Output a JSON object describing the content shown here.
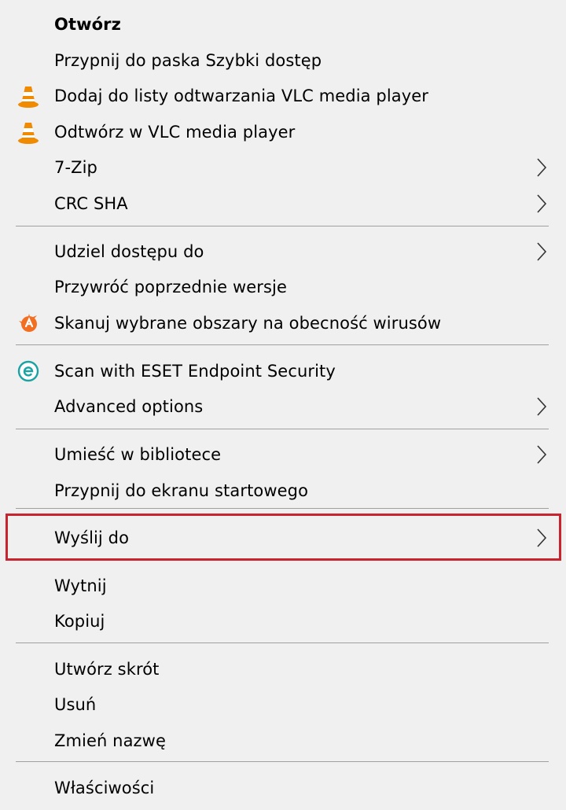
{
  "menu": {
    "groups": [
      [
        {
          "label": "Otwórz",
          "bold": true,
          "icon": null,
          "submenu": false
        },
        {
          "label": "Przypnij do paska Szybki dostęp",
          "bold": false,
          "icon": null,
          "submenu": false
        },
        {
          "label": "Dodaj do listy odtwarzania VLC media player",
          "bold": false,
          "icon": "vlc-cone-icon",
          "submenu": false
        },
        {
          "label": "Odtwórz w VLC media player",
          "bold": false,
          "icon": "vlc-cone-icon",
          "submenu": false
        },
        {
          "label": "7-Zip",
          "bold": false,
          "icon": null,
          "submenu": true
        },
        {
          "label": "CRC SHA",
          "bold": false,
          "icon": null,
          "submenu": true
        }
      ],
      [
        {
          "label": "Udziel dostępu do",
          "bold": false,
          "icon": null,
          "submenu": true
        },
        {
          "label": "Przywróć poprzednie wersje",
          "bold": false,
          "icon": null,
          "submenu": false
        },
        {
          "label": "Skanuj wybrane obszary na obecność wirusów",
          "bold": false,
          "icon": "avast-icon",
          "submenu": false
        }
      ],
      [
        {
          "label": "Scan with ESET Endpoint Security",
          "bold": false,
          "icon": "eset-icon",
          "submenu": false
        },
        {
          "label": "Advanced options",
          "bold": false,
          "icon": null,
          "submenu": true
        }
      ],
      [
        {
          "label": "Umieść w bibliotece",
          "bold": false,
          "icon": null,
          "submenu": true
        },
        {
          "label": "Przypnij do ekranu startowego",
          "bold": false,
          "icon": null,
          "submenu": false
        },
        {
          "label": "Wyślij do",
          "bold": false,
          "icon": null,
          "submenu": true,
          "highlighted": true
        }
      ],
      [
        {
          "label": "Wytnij",
          "bold": false,
          "icon": null,
          "submenu": false
        },
        {
          "label": "Kopiuj",
          "bold": false,
          "icon": null,
          "submenu": false
        }
      ],
      [
        {
          "label": "Utwórz skrót",
          "bold": false,
          "icon": null,
          "submenu": false
        },
        {
          "label": "Usuń",
          "bold": false,
          "icon": null,
          "submenu": false
        },
        {
          "label": "Zmień nazwę",
          "bold": false,
          "icon": null,
          "submenu": false
        }
      ],
      [
        {
          "label": "Właściwości",
          "bold": false,
          "icon": null,
          "submenu": false
        }
      ]
    ]
  },
  "colors": {
    "background": "#f0f0f0",
    "separator": "#a0a0a0",
    "highlight_border": "#c8242f",
    "vlc_orange": "#f08a00",
    "avast_orange": "#f26f21",
    "eset_teal": "#1aa3a3"
  }
}
